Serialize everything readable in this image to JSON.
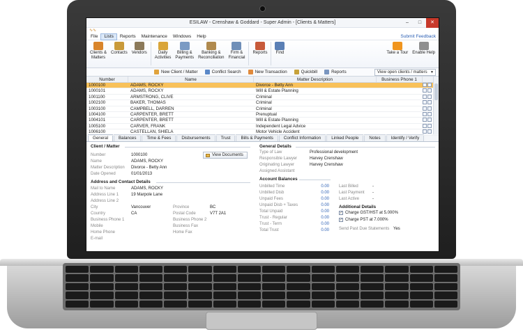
{
  "window": {
    "title": "ESILAW - Crenshaw & Goddard - Super Admin - [Clients & Matters]",
    "controls": [
      "–",
      "□",
      "✕"
    ]
  },
  "qat": {
    "label": "∿∿"
  },
  "menu": {
    "items": [
      "File",
      "Lists",
      "Reports",
      "Maintenance",
      "Windows",
      "Help"
    ],
    "active": "Lists",
    "feedback": "Submit Feedback"
  },
  "ribbon": {
    "buttons": [
      {
        "label": "Clients &\nMatters",
        "icon": "clients-matters-icon",
        "color": "#d9852b"
      },
      {
        "label": "Contacts",
        "icon": "contacts-icon",
        "color": "#c99a3a"
      },
      {
        "label": "Vendors",
        "icon": "vendors-icon",
        "color": "#8c7a5a"
      },
      {
        "label": "Daily\nActivities",
        "icon": "daily-activities-icon",
        "color": "#d9a53a"
      },
      {
        "label": "Billing &\nPayments",
        "icon": "billing-payments-icon",
        "color": "#7b9bc4"
      },
      {
        "label": "Banking &\nReconciliation",
        "icon": "banking-icon",
        "color": "#b08a4e"
      },
      {
        "label": "Firm &\nFinancial",
        "icon": "firm-financial-icon",
        "color": "#6f8fb8"
      },
      {
        "label": "Reports",
        "icon": "reports-icon",
        "color": "#c75a3a"
      },
      {
        "label": "Find",
        "icon": "find-icon",
        "color": "#5a7fb5"
      }
    ],
    "right": [
      {
        "label": "Take a Tour",
        "icon": "tour-icon",
        "color": "#f0951e"
      },
      {
        "label": "Enable Help",
        "icon": "help-icon",
        "color": "#8f8f8f"
      }
    ]
  },
  "toolbar": {
    "items": [
      {
        "label": "New Client / Matter",
        "color": "#e0a33c"
      },
      {
        "label": "Conflict Search",
        "color": "#5a88c8"
      },
      {
        "label": "New Transaction",
        "color": "#e08a3c"
      },
      {
        "label": "Quickbill",
        "color": "#c7a23a"
      },
      {
        "label": "Reports",
        "color": "#7a96c0"
      }
    ],
    "view_select": "View open clients / matters"
  },
  "grid": {
    "headers": [
      "Number",
      "Name",
      "Matter Description",
      "Business Phone 1"
    ],
    "rows": [
      [
        "1000100",
        "ADAMS, ROCKY",
        "Divorce - Betty Ann",
        ""
      ],
      [
        "1000101",
        "ADAMS, ROCKY",
        "Will & Estate Planning",
        ""
      ],
      [
        "1001100",
        "ARMSTRONG, CLIVE",
        "Criminal",
        ""
      ],
      [
        "1002100",
        "BAKER, THOMAS",
        "Criminal",
        ""
      ],
      [
        "1003100",
        "CAMPBELL, DARREN",
        "Criminal",
        ""
      ],
      [
        "1004100",
        "CARPENTER, BRETT",
        "Prenuptual",
        ""
      ],
      [
        "1004101",
        "CARPENTER, BRETT",
        "Will & Estate Planning",
        ""
      ],
      [
        "1005100",
        "CARVER, FRANK",
        "Independent Legal Advice",
        ""
      ],
      [
        "1006100",
        "CASTELLAN, SHIELA",
        "Motor Vehicle Accident",
        ""
      ]
    ],
    "selected_index": 0
  },
  "tabs": {
    "items": [
      "General",
      "Balances",
      "Time & Fees",
      "Disbursements",
      "Trust",
      "Bills & Payments",
      "Conflict Information",
      "Linked People",
      "Notes",
      "Identify / Verify"
    ],
    "active": 0
  },
  "detail": {
    "client_matter_title": "Client / Matter",
    "view_documents": "View Documents",
    "fields_left": [
      {
        "label": "Number",
        "value": "1000100"
      },
      {
        "label": "Name",
        "value": "ADAMS, ROCKY"
      },
      {
        "label": "Matter Description",
        "value": "Divorce - Betty Ann"
      },
      {
        "label": "Date Opened",
        "value": "01/01/2013"
      }
    ],
    "address_title": "Address and Contact Details",
    "address_left": [
      {
        "label": "Mail to Name",
        "value": "ADAMS, ROCKY"
      },
      {
        "label": "Address Line 1",
        "value": "19 Marpole Lane"
      },
      {
        "label": "Address Line 2",
        "value": ""
      },
      {
        "label": "City",
        "value": "Vancouver"
      },
      {
        "label": "Country",
        "value": "CA"
      },
      {
        "label": "Business Phone 1",
        "value": ""
      },
      {
        "label": "Mobile",
        "value": ""
      },
      {
        "label": "Home Phone",
        "value": ""
      },
      {
        "label": "E-mail",
        "value": ""
      }
    ],
    "address_mid": [
      {
        "label": "Province",
        "value": "BC"
      },
      {
        "label": "Postal Code",
        "value": "V7T 2A1"
      },
      {
        "label": "Business Phone 2",
        "value": ""
      },
      {
        "label": "Business Fax",
        "value": ""
      },
      {
        "label": "Home Fax",
        "value": ""
      }
    ],
    "general_title": "General Details",
    "general": [
      {
        "label": "Type of Law",
        "value": "Professional development"
      },
      {
        "label": "Responsible Lawyer",
        "value": "Harvey Crenshaw"
      },
      {
        "label": "Originating Lawyer",
        "value": "Harvey Crenshaw"
      },
      {
        "label": "Assigned Assistant",
        "value": ""
      }
    ],
    "balances_title": "Account Balances",
    "balances": [
      {
        "label": "Unbilled Time",
        "value": "0.00"
      },
      {
        "label": "Unbilled Disb",
        "value": "0.00"
      },
      {
        "label": "Unpaid Fees",
        "value": "0.00"
      },
      {
        "label": "Unpaid Disb + Taxes",
        "value": "0.00"
      },
      {
        "label": "Total Unpaid",
        "value": "0.00"
      },
      {
        "label": "Trust - Regular",
        "value": "0.00"
      },
      {
        "label": "Trust - Term",
        "value": "0.00"
      },
      {
        "label": "Total Trust",
        "value": "0.00"
      }
    ],
    "last": [
      {
        "label": "Last Billed",
        "value": "-"
      },
      {
        "label": "Last Payment",
        "value": "-"
      },
      {
        "label": "Last Active",
        "value": "-"
      }
    ],
    "additional_title": "Additional Details",
    "checks": [
      {
        "label": "Charge GST/HST at 5.000%",
        "checked": "✓"
      },
      {
        "label": "Charge PST at 7.000%",
        "checked": "✓"
      }
    ],
    "past_due": {
      "label": "Send Past Due Statements",
      "value": "Yes"
    }
  }
}
